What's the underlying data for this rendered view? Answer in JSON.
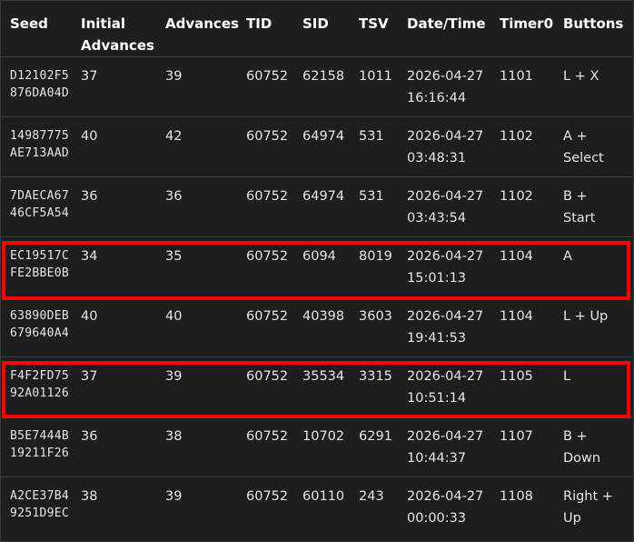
{
  "columns": [
    "Seed",
    "Initial Advances",
    "Advances",
    "TID",
    "SID",
    "TSV",
    "Date/Time",
    "Timer0",
    "Buttons"
  ],
  "rows": [
    {
      "seed": [
        "D12102F5",
        "876DA04D"
      ],
      "initial_advances": "37",
      "advances": "39",
      "tid": "60752",
      "sid": "62158",
      "tsv": "1011",
      "datetime": [
        "2026-04-27",
        "16:16:44"
      ],
      "timer0": "1101",
      "buttons": [
        "L + X"
      ],
      "highlighted": false
    },
    {
      "seed": [
        "14987775",
        "AE713AAD"
      ],
      "initial_advances": "40",
      "advances": "42",
      "tid": "60752",
      "sid": "64974",
      "tsv": "531",
      "datetime": [
        "2026-04-27",
        "03:48:31"
      ],
      "timer0": "1102",
      "buttons": [
        "A +",
        "Select"
      ],
      "highlighted": false
    },
    {
      "seed": [
        "7DAECA67",
        "46CF5A54"
      ],
      "initial_advances": "36",
      "advances": "36",
      "tid": "60752",
      "sid": "64974",
      "tsv": "531",
      "datetime": [
        "2026-04-27",
        "03:43:54"
      ],
      "timer0": "1102",
      "buttons": [
        "B +",
        "Start"
      ],
      "highlighted": false
    },
    {
      "seed": [
        "EC19517C",
        "FE2BBE0B"
      ],
      "initial_advances": "34",
      "advances": "35",
      "tid": "60752",
      "sid": "6094",
      "tsv": "8019",
      "datetime": [
        "2026-04-27",
        "15:01:13"
      ],
      "timer0": "1104",
      "buttons": [
        "A"
      ],
      "highlighted": true
    },
    {
      "seed": [
        "63890DEB",
        "679640A4"
      ],
      "initial_advances": "40",
      "advances": "40",
      "tid": "60752",
      "sid": "40398",
      "tsv": "3603",
      "datetime": [
        "2026-04-27",
        "19:41:53"
      ],
      "timer0": "1104",
      "buttons": [
        "L + Up"
      ],
      "highlighted": false
    },
    {
      "seed": [
        "F4F2FD75",
        "92A01126"
      ],
      "initial_advances": "37",
      "advances": "39",
      "tid": "60752",
      "sid": "35534",
      "tsv": "3315",
      "datetime": [
        "2026-04-27",
        "10:51:14"
      ],
      "timer0": "1105",
      "buttons": [
        "L"
      ],
      "highlighted": true
    },
    {
      "seed": [
        "B5E7444B",
        "19211F26"
      ],
      "initial_advances": "36",
      "advances": "38",
      "tid": "60752",
      "sid": "10702",
      "tsv": "6291",
      "datetime": [
        "2026-04-27",
        "10:44:37"
      ],
      "timer0": "1107",
      "buttons": [
        "B +",
        "Down"
      ],
      "highlighted": false
    },
    {
      "seed": [
        "A2CE37B4",
        "9251D9EC"
      ],
      "initial_advances": "38",
      "advances": "39",
      "tid": "60752",
      "sid": "60110",
      "tsv": "243",
      "datetime": [
        "2026-04-27",
        "00:00:33"
      ],
      "timer0": "1108",
      "buttons": [
        "Right +",
        "Up"
      ],
      "highlighted": false
    }
  ],
  "colors": {
    "background": "#1c1e20",
    "header_text": "#ffffff",
    "cell_text": "#e6e6e6",
    "row_divider": "#3b3e42",
    "highlight_border": "#ff0000"
  }
}
